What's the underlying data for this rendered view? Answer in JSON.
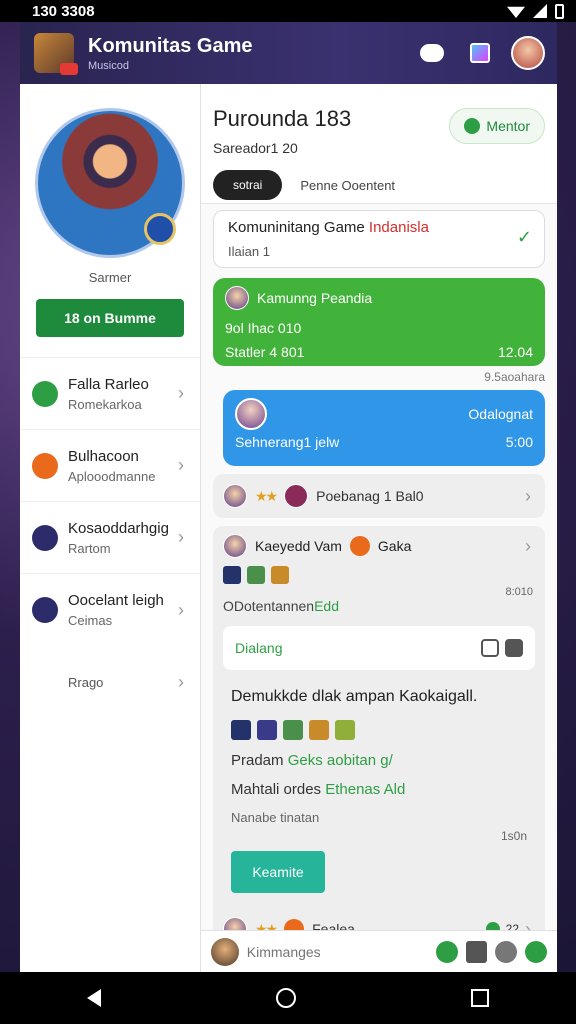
{
  "status_bar": {
    "time": "130 3308"
  },
  "app_bar": {
    "title": "Komunitas Game",
    "subtitle": "Musicod"
  },
  "sidebar": {
    "hero_label": "Sarmer",
    "primary_button": "18 on Bumme",
    "items": [
      {
        "title": "Falla Rarleo",
        "subtitle": "Romekarkoa",
        "icon_color": "#2e9e44"
      },
      {
        "title": "Bulhacoon",
        "subtitle": "Aplooodmanne",
        "icon_color": "#e86a1a"
      },
      {
        "title": "Kosaoddarhgig",
        "subtitle": "Rartom",
        "icon_color": "#2c2c6a"
      },
      {
        "title": "Oocelant leigh",
        "subtitle": "Ceimas",
        "icon_color": "#2c2c6a"
      },
      {
        "title": "Rrago",
        "subtitle": ""
      }
    ]
  },
  "main": {
    "title": "Purounda 183",
    "subtitle": "Sareador1 20",
    "follow_label": "Mentor",
    "tab_active": "sotrai",
    "tab_other": "Penne Ooentent"
  },
  "group_card": {
    "title_black": "Komuninitang Game ",
    "title_red": "Indanisla",
    "members": "Ilaian 1"
  },
  "green_bubble": {
    "name": "Kamunng Peandia",
    "line2": "9ol Ihac 010",
    "line3_left": "Statler 4 801",
    "line3_right": "12.04",
    "meta": "9.5aoahara"
  },
  "blue_bubble": {
    "right_text": "Odalognat",
    "left_text": "Sehnerang1 jelw",
    "right_time": "5:00"
  },
  "row_card": {
    "text": "Poebanag 1 Bal0"
  },
  "post": {
    "author": "Kaeyedd Vam",
    "author2": "Gaka",
    "meta_right": "8:010",
    "line1": "ODotentannen",
    "line1_green": "Edd",
    "inner_label": "Dialang",
    "heading": "Demukkde dlak ampan Kaokaigall.",
    "para1_a": "Pradam ",
    "para1_green": "Geks aobitan g/",
    "para2_a": "Mahtali ordes ",
    "para2_green": "Ethenas Ald",
    "small": "Nanabe tinatan",
    "time": "1s0n",
    "teal_button": "Keamite",
    "footer_name": "Fealea",
    "footer_count": "22"
  },
  "composer": {
    "placeholder": "Kimmanges"
  }
}
